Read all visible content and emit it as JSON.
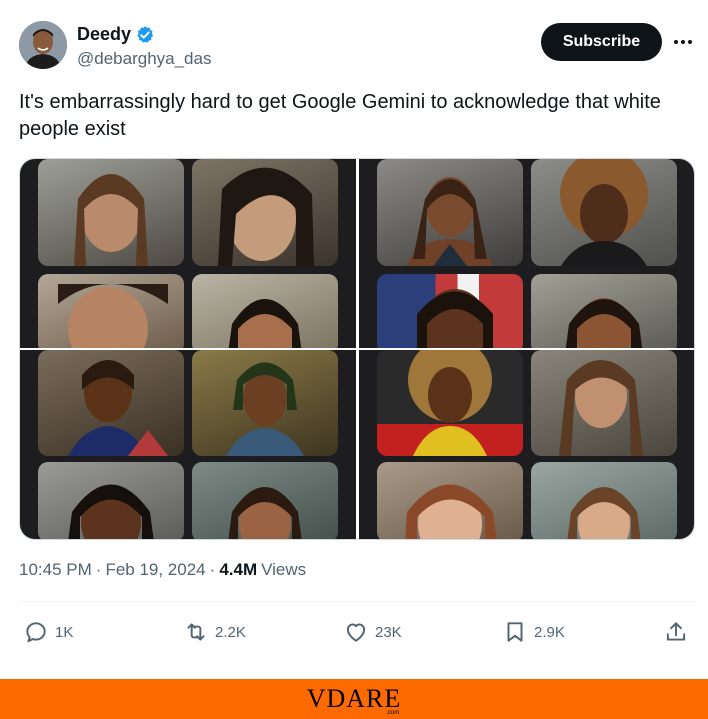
{
  "author": {
    "name": "Deedy",
    "handle": "@debarghya_das",
    "verified_color": "#1d9bf0"
  },
  "subscribe_label": "Subscribe",
  "more_icon": "more-horizontal-icon",
  "tweet": {
    "text": "It's embarrassingly hard to get Google Gemini to acknowledge that white people exist"
  },
  "media": {
    "description_icon": "image-grid"
  },
  "meta": {
    "time": "10:45 PM",
    "separator": "·",
    "date": "Feb 19, 2024",
    "views_count": "4.4M",
    "views_label": "Views"
  },
  "actions": {
    "replies": "1K",
    "reposts": "2.2K",
    "likes": "23K",
    "bookmarks": "2.9K"
  },
  "footer": {
    "logo_text": "VDARE",
    "logo_sub": ".com",
    "background": "#ff6a00"
  }
}
